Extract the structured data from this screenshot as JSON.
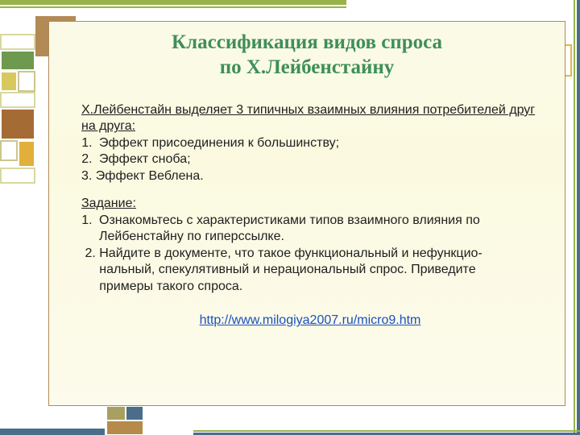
{
  "title_line1": "Классификация видов спроса",
  "title_line2": "по Х.Лейбенстайну",
  "intro": "Х.Лейбенстайн выделяет 3 типичных взаимных влияния потребителей друг на друга:",
  "effects": [
    "Эффект присоединения к большинству;",
    "Эффект сноба;"
  ],
  "effect3": " 3.  Эффект Веблена.",
  "task_label": "Задание:",
  "tasks_first": "Ознакомьтесь с характеристиками типов взаимного влияния по Лейбенстайну по гиперссылке.",
  "tasks_rest": " 2. Найдите в документе, что такое функциональный и нефункцио-\n     нальный, спекулятивный и нерациональный спрос. Приведите\n     примеры такого спроса.",
  "link_text": "http://www.milogiya2007.ru/micro9.htm",
  "link_href": "http://www.milogiya2007.ru/micro9.htm",
  "colors": {
    "title": "#3f8f57",
    "accent_green": "#98b24a",
    "accent_blue": "#4a6e8a",
    "accent_tan": "#b28a56",
    "link": "#1a4fbf"
  }
}
